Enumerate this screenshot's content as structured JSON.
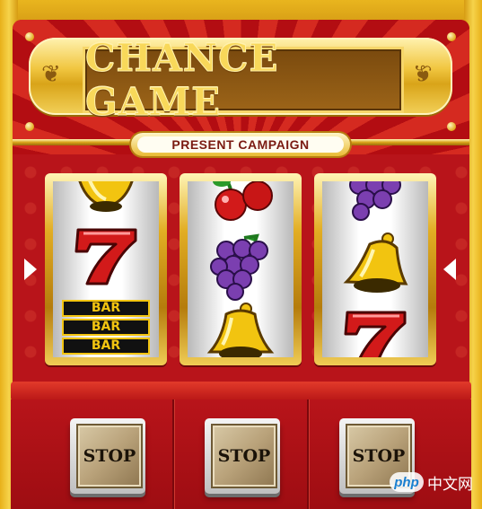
{
  "title": "CHANCE GAME",
  "subtitle": "PRESENT CAMPAIGN",
  "reels": [
    {
      "symbols": [
        "bell-partial",
        "seven",
        "triple-bar"
      ]
    },
    {
      "symbols": [
        "cherry-partial",
        "grapes",
        "bell"
      ]
    },
    {
      "symbols": [
        "grapes-partial",
        "bell",
        "seven"
      ]
    }
  ],
  "bar_label": "BAR",
  "stop_buttons": [
    "STOP",
    "STOP",
    "STOP"
  ],
  "watermark": {
    "logo": "php",
    "text": "中文网"
  },
  "colors": {
    "cabinet_red": "#c01818",
    "gold": "#e2ad23",
    "bell_yellow": "#f2c410",
    "seven_red": "#d21a1a",
    "grape_purple": "#7b3fb0",
    "stop_face": "#b9a27a"
  },
  "icons": [
    "bell-icon",
    "seven-icon",
    "bar-icon",
    "cherry-icon",
    "grapes-icon",
    "arrow-left-icon",
    "arrow-right-icon"
  ]
}
